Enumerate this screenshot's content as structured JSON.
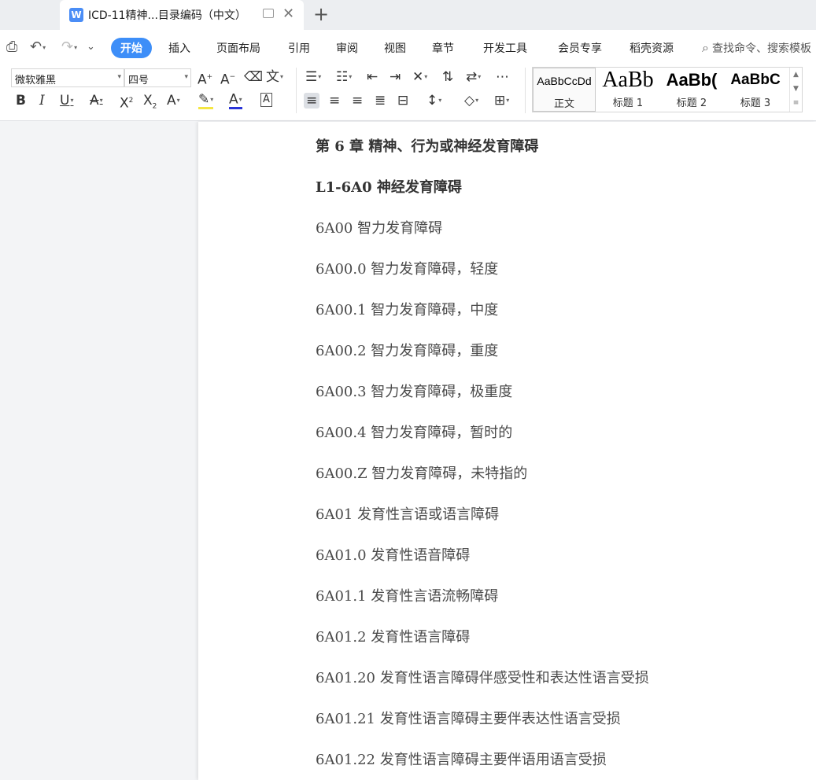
{
  "tab": {
    "title": "ICD-11精神...目录编码（中文）",
    "icon": "W"
  },
  "menu": {
    "items": [
      "开始",
      "插入",
      "页面布局",
      "引用",
      "审阅",
      "视图",
      "章节",
      "开发工具",
      "会员专享",
      "稻壳资源"
    ],
    "active": "开始",
    "search_placeholder": "查找命令、搜索模板"
  },
  "ribbon": {
    "font_name": "微软雅黑",
    "font_size": "四号",
    "styles": [
      {
        "sample": "AaBbCcDd",
        "name": "正文"
      },
      {
        "sample": "AaBb",
        "name": "标题 1"
      },
      {
        "sample": "AaBb(",
        "name": "标题 2"
      },
      {
        "sample": "AaBbC",
        "name": "标题 3"
      }
    ]
  },
  "document": {
    "lines": [
      {
        "text": "第 6 章 精神、行为或神经发育障碍",
        "bold": true
      },
      {
        "text": "L1-6A0 神经发育障碍",
        "bold": true
      },
      {
        "text": "6A00 智力发育障碍",
        "bold": false
      },
      {
        "text": "6A00.0 智力发育障碍，轻度",
        "bold": false
      },
      {
        "text": "6A00.1 智力发育障碍，中度",
        "bold": false
      },
      {
        "text": "6A00.2 智力发育障碍，重度",
        "bold": false
      },
      {
        "text": "6A00.3 智力发育障碍，极重度",
        "bold": false
      },
      {
        "text": "6A00.4 智力发育障碍，暂时的",
        "bold": false
      },
      {
        "text": "6A00.Z 智力发育障碍，未特指的",
        "bold": false
      },
      {
        "text": "6A01 发育性言语或语言障碍",
        "bold": false
      },
      {
        "text": "6A01.0 发育性语音障碍",
        "bold": false
      },
      {
        "text": "6A01.1 发育性言语流畅障碍",
        "bold": false
      },
      {
        "text": "6A01.2 发育性语言障碍",
        "bold": false
      },
      {
        "text": "6A01.20 发育性语言障碍伴感受性和表达性语言受损",
        "bold": false
      },
      {
        "text": "6A01.21 发育性语言障碍主要伴表达性语言受损",
        "bold": false
      },
      {
        "text": "6A01.22 发育性语言障碍主要伴语用语言受损",
        "bold": false
      }
    ]
  },
  "colors": {
    "accent": "#3d8ef8",
    "doc_icon": "#4a8df6",
    "highlight": "#f5e642",
    "font_color": "#2a34d8"
  },
  "icons": {
    "print_preview": "print-preview-icon",
    "undo": "undo-icon",
    "redo": "redo-icon",
    "more": "chevron-down-icon",
    "search": "search-icon"
  }
}
